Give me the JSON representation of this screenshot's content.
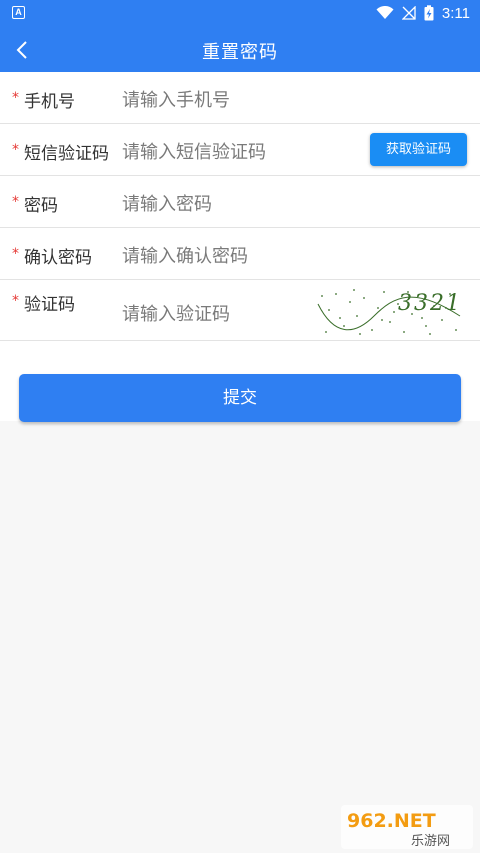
{
  "status_bar": {
    "time": "3:11",
    "app_icon": "A"
  },
  "header": {
    "title": "重置密码"
  },
  "form": {
    "required_mark": "*",
    "fields": [
      {
        "label": "手机号",
        "placeholder": "请输入手机号"
      },
      {
        "label": "短信验证码",
        "placeholder": "请输入短信验证码",
        "button_label": "获取验证码"
      },
      {
        "label": "密码",
        "placeholder": "请输入密码"
      },
      {
        "label": "确认密码",
        "placeholder": "请输入确认密码"
      },
      {
        "label": "验证码",
        "placeholder": "请输入验证码",
        "captcha_text": "3321"
      }
    ]
  },
  "submit_label": "提交",
  "watermark": {
    "brand": "962.NET",
    "sub": "乐游网"
  },
  "colors": {
    "primary": "#2f7ff2",
    "button": "#1a8df4",
    "required": "#e53935",
    "placeholder": "#7a7a7a"
  }
}
